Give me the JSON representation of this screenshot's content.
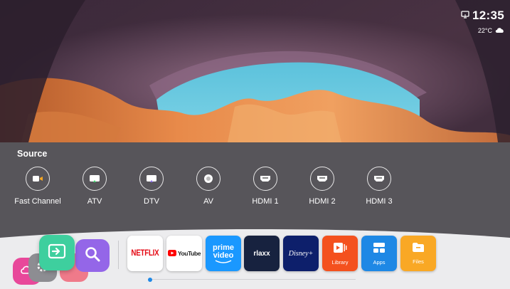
{
  "status": {
    "time": "12:35",
    "temperature": "22°C",
    "network_icon": "tv-cast-icon",
    "weather_icon": "cloud-icon"
  },
  "source": {
    "title": "Source",
    "items": [
      {
        "label": "Fast Channel",
        "icon": "video-camera-icon"
      },
      {
        "label": "ATV",
        "icon": "antenna-tv-icon"
      },
      {
        "label": "DTV",
        "icon": "digital-tv-icon"
      },
      {
        "label": "AV",
        "icon": "av-circle-icon"
      },
      {
        "label": "HDMI 1",
        "icon": "hdmi-port-icon"
      },
      {
        "label": "HDMI 2",
        "icon": "hdmi-port-icon"
      },
      {
        "label": "HDMI 3",
        "icon": "hdmi-port-icon"
      }
    ]
  },
  "dock": {
    "quick_buttons": [
      "cloud-icon",
      "settings-icon",
      "input-source-icon",
      "search-icon"
    ],
    "apps": [
      {
        "name": "NETFLIX"
      },
      {
        "name": "YouTube"
      },
      {
        "name": "prime video"
      },
      {
        "name": "rlaxx"
      },
      {
        "name": "Disney+"
      },
      {
        "name": "Library"
      },
      {
        "name": "Apps"
      },
      {
        "name": "Files"
      }
    ]
  },
  "colors": {
    "panel": "#58585c",
    "dock": "#ececee",
    "accent_green": "#3ecf9e",
    "accent_purple": "#9466e8"
  }
}
